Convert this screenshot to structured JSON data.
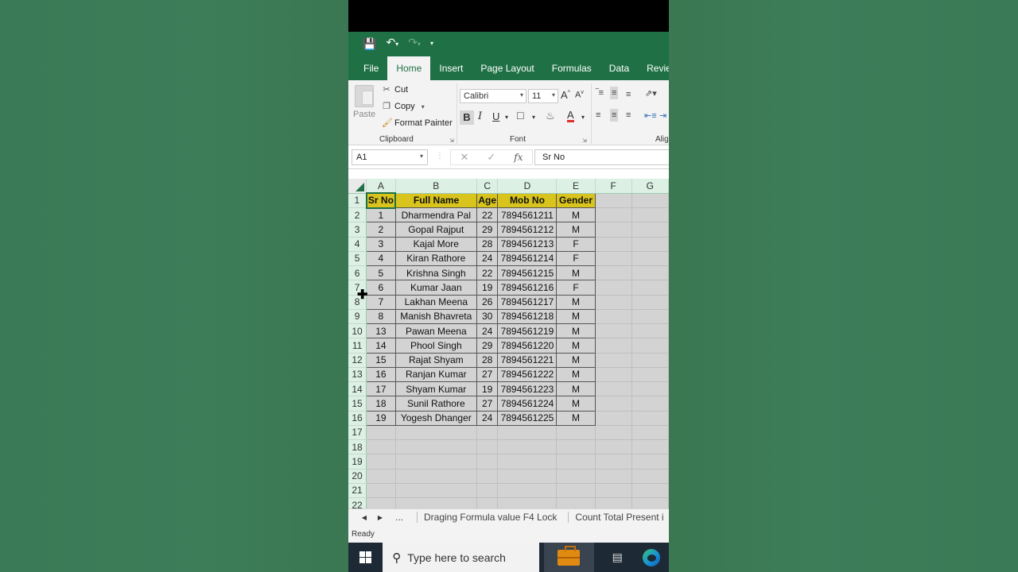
{
  "qat": {
    "save_icon": "save-icon",
    "undo_icon": "undo-icon",
    "redo_icon": "redo-icon",
    "customize_icon": "customize-qat-icon"
  },
  "tabs": [
    "File",
    "Home",
    "Insert",
    "Page Layout",
    "Formulas",
    "Data",
    "Revie"
  ],
  "active_tab": "Home",
  "ribbon": {
    "clipboard": {
      "paste": "Paste",
      "cut": "Cut",
      "copy": "Copy",
      "format_painter": "Format Painter",
      "label": "Clipboard"
    },
    "font": {
      "name": "Calibri",
      "size": "11",
      "label": "Font"
    },
    "alignment": {
      "label": "Aligi"
    }
  },
  "formula_bar": {
    "name_box": "A1",
    "content": "Sr No"
  },
  "columns": [
    "A",
    "B",
    "C",
    "D",
    "E",
    "F",
    "G"
  ],
  "table": {
    "headers": [
      "Sr No",
      "Full Name",
      "Age",
      "Mob No",
      "Gender"
    ],
    "rows": [
      [
        "1",
        "Dharmendra Pal",
        "22",
        "7894561211",
        "M"
      ],
      [
        "2",
        "Gopal Rajput",
        "29",
        "7894561212",
        "M"
      ],
      [
        "3",
        "Kajal More",
        "28",
        "7894561213",
        "F"
      ],
      [
        "4",
        "Kiran Rathore",
        "24",
        "7894561214",
        "F"
      ],
      [
        "5",
        "Krishna Singh",
        "22",
        "7894561215",
        "M"
      ],
      [
        "6",
        "Kumar Jaan",
        "19",
        "7894561216",
        "F"
      ],
      [
        "7",
        "Lakhan Meena",
        "26",
        "7894561217",
        "M"
      ],
      [
        "8",
        "Manish Bhavreta",
        "30",
        "7894561218",
        "M"
      ],
      [
        "13",
        "Pawan Meena",
        "24",
        "7894561219",
        "M"
      ],
      [
        "14",
        "Phool Singh",
        "29",
        "7894561220",
        "M"
      ],
      [
        "15",
        "Rajat Shyam",
        "28",
        "7894561221",
        "M"
      ],
      [
        "16",
        "Ranjan Kumar",
        "27",
        "7894561222",
        "M"
      ],
      [
        "17",
        "Shyam Kumar",
        "19",
        "7894561223",
        "M"
      ],
      [
        "18",
        "Sunil Rathore",
        "27",
        "7894561224",
        "M"
      ],
      [
        "19",
        "Yogesh Dhanger",
        "24",
        "7894561225",
        "M"
      ]
    ]
  },
  "row_numbers": [
    "1",
    "2",
    "3",
    "4",
    "5",
    "6",
    "7",
    "8",
    "9",
    "10",
    "11",
    "12",
    "13",
    "14",
    "15",
    "16",
    "17",
    "18",
    "19",
    "20",
    "21",
    "22"
  ],
  "sheet_tabs": {
    "more": "...",
    "tab1": "Draging Formula value F4 Lock",
    "tab2": "Count Total Present i"
  },
  "status": "Ready",
  "taskbar": {
    "search_placeholder": "Type here to search"
  },
  "colors": {
    "excel_green": "#1f7145",
    "header_fill": "#d8c41c",
    "grid_fill": "#d3d3d3"
  }
}
